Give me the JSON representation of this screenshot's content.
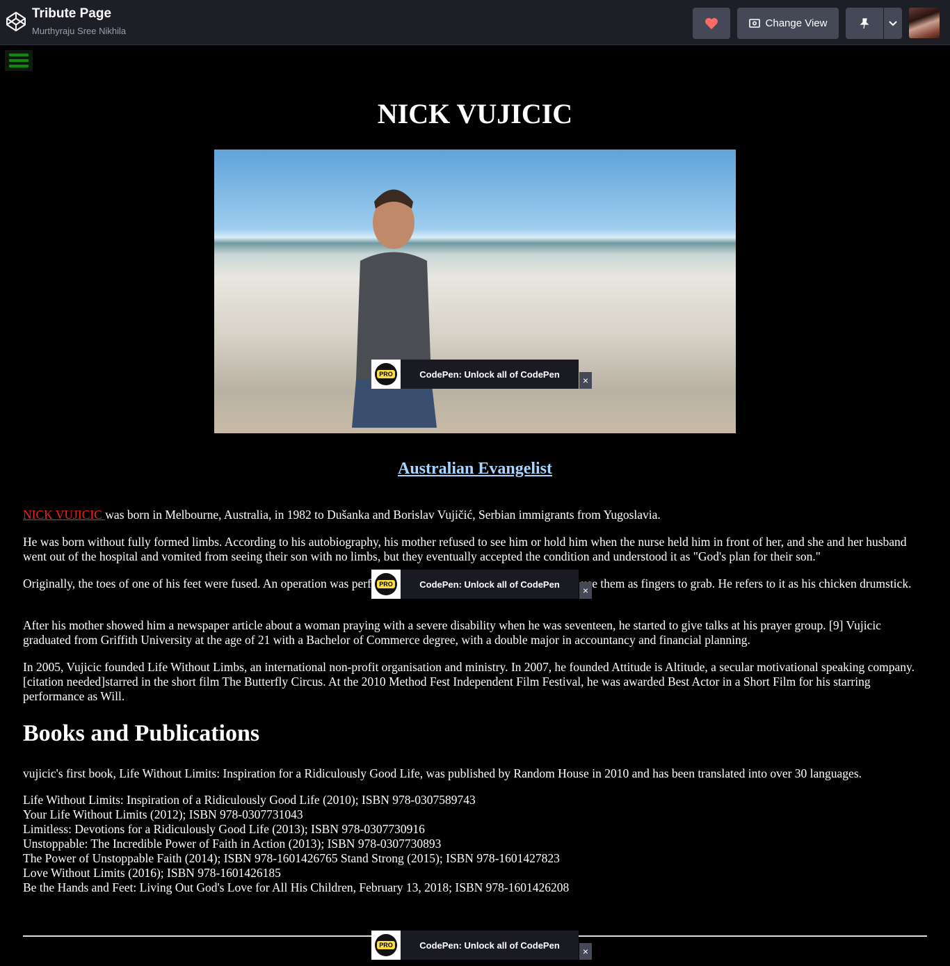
{
  "header": {
    "title": "Tribute Page",
    "author": "Murthyraju Sree Nikhila",
    "change_view_label": "Change View"
  },
  "page": {
    "title": "NICK VUJICIC",
    "subtitle": "Australian Evangelist",
    "intro_link": "NICK VUJICIC ",
    "intro_rest": "was born in Melbourne, Australia, in 1982 to Dušanka and Borislav Vujičić, Serbian immigrants from Yugoslavia.",
    "paragraph2": "He was born without fully formed limbs. According to his autobiography, his mother refused to see him or hold him when the nurse held him in front of her, and she and her husband went out of the hospital and vomited from seeing their son with no limbs, but they eventually accepted the condition and understood it as \"God's plan for their son.\"",
    "paragraph3": "Originally, the toes of one of his feet were fused. An operation was performed to separate the toes so that he could use them as fingers to grab. He refers to it as his chicken drumstick.",
    "paragraph4": "After his mother showed him a newspaper article about a woman praying with a severe disability when he was seventeen, he started to give talks at his prayer group. [9] Vujicic graduated from Griffith University at the age of 21 with a Bachelor of Commerce degree, with a double major in accountancy and financial planning.",
    "paragraph5": "In 2005, Vujicic founded Life Without Limbs, an international non-profit organisation and ministry. In 2007, he founded Attitude is Altitude, a secular motivational speaking company.[citation needed]starred in the short film The Butterfly Circus. At the 2010 Method Fest Independent Film Festival, he was awarded Best Actor in a Short Film for his starring performance as Will.",
    "books_heading": "Books and Publications",
    "books_intro": "vujicic's first book, Life Without Limits: Inspiration for a Ridiculously Good Life, was published by Random House in 2010 and has been translated into over 30 languages.",
    "books": [
      "Life Without Limits: Inspiration of a Ridiculously Good Life (2010); ISBN 978-0307589743",
      "Your Life Without Limits (2012); ISBN 978-0307731043",
      "Limitless: Devotions for a Ridiculously Good Life (2013); ISBN 978-0307730916",
      "Unstoppable: The Incredible Power of Faith in Action (2013); ISBN 978-0307730893",
      "The Power of Unstoppable Faith (2014); ISBN 978-1601426765 Stand Strong (2015); ISBN 978-1601427823",
      "Love Without Limits (2016); ISBN 978-1601426185",
      "Be the Hands and Feet: Living Out God's Love for All His Children, February 13, 2018; ISBN 978-1601426208"
    ]
  },
  "promo": {
    "badge": "PRO",
    "text": "CodePen: Unlock all of CodePen",
    "close": "×"
  },
  "colors": {
    "header_bg": "#1e1f26",
    "button_bg": "#444857",
    "heart": "#ff6b6b",
    "link_red": "#ff1a1a",
    "subtitle_link": "#a9d6ff",
    "hamburger": "#0e8a0e"
  },
  "icons": [
    "codepen-logo-icon",
    "heart-icon",
    "change-view-icon",
    "pin-icon",
    "chevron-down-icon",
    "hamburger-icon",
    "close-icon"
  ]
}
